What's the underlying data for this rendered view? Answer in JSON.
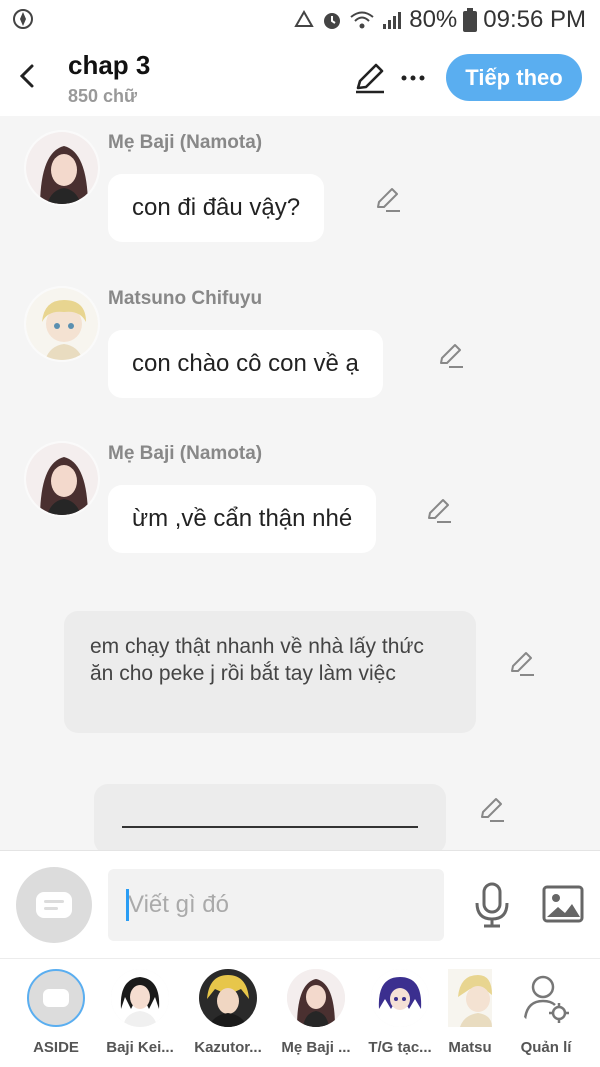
{
  "status_bar": {
    "battery": "80%",
    "time": "09:56 PM"
  },
  "header": {
    "title": "chap 3",
    "word_count": "850 chữ",
    "next_button": "Tiếp theo"
  },
  "messages": [
    {
      "speaker": "Mẹ Baji (Namota)",
      "text": "con đi đâu vậy?"
    },
    {
      "speaker": "Matsuno Chifuyu",
      "text": "con chào cô con về ạ"
    },
    {
      "speaker": "Mẹ Baji (Namota)",
      "text": "ừm ,về cẩn thận nhé"
    }
  ],
  "narration": "em chạy thật nhanh về nhà lấy thức ăn cho peke j rồi bắt tay làm việc",
  "input": {
    "placeholder": "Viết gì đó"
  },
  "characters": [
    {
      "label": "ASIDE"
    },
    {
      "label": "Baji Kei..."
    },
    {
      "label": "Kazutor..."
    },
    {
      "label": "Mẹ Baji ..."
    },
    {
      "label": "T/G tạc..."
    },
    {
      "label": "Matsu"
    },
    {
      "label": "Quản lí"
    }
  ],
  "colors": {
    "accent": "#5aaef0",
    "chat_bg": "#f5f5f5",
    "bubble": "#ffffff",
    "narration_bg": "#ececec"
  }
}
